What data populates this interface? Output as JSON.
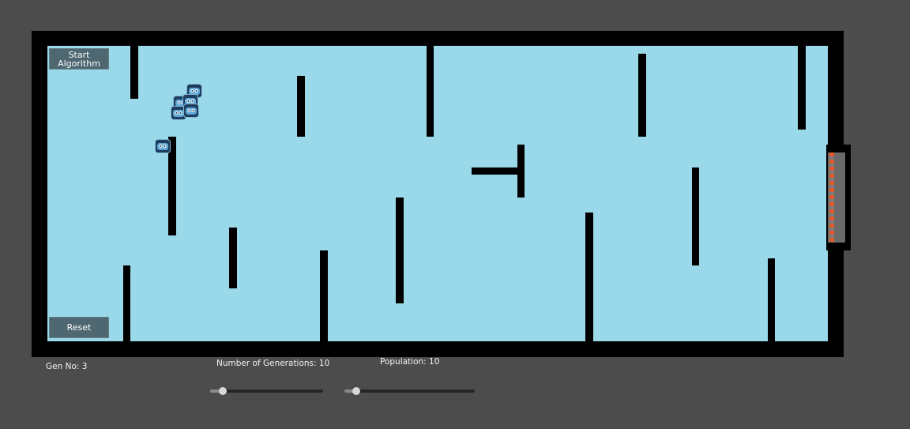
{
  "game": {
    "gen_label": "Gen No: 3",
    "generations_label": "Number of Generations: 10",
    "population_label": "Population: 10",
    "generations_value": 10,
    "population_value": 10,
    "agents_visible": 6
  },
  "buttons": {
    "start": "Start Algorithm",
    "reset": "Reset"
  },
  "sliders": {
    "generations_level": 0.11,
    "population_level": 0.09
  },
  "colors": {
    "background": "#4c4c4c",
    "floor": "#9ad9e9",
    "wall": "#000000",
    "button": "#4e6770",
    "goal_stripe": "#e25a2c"
  },
  "icons": {
    "agent": "robot-agent-icon",
    "goal": "goal-gate-icon"
  }
}
